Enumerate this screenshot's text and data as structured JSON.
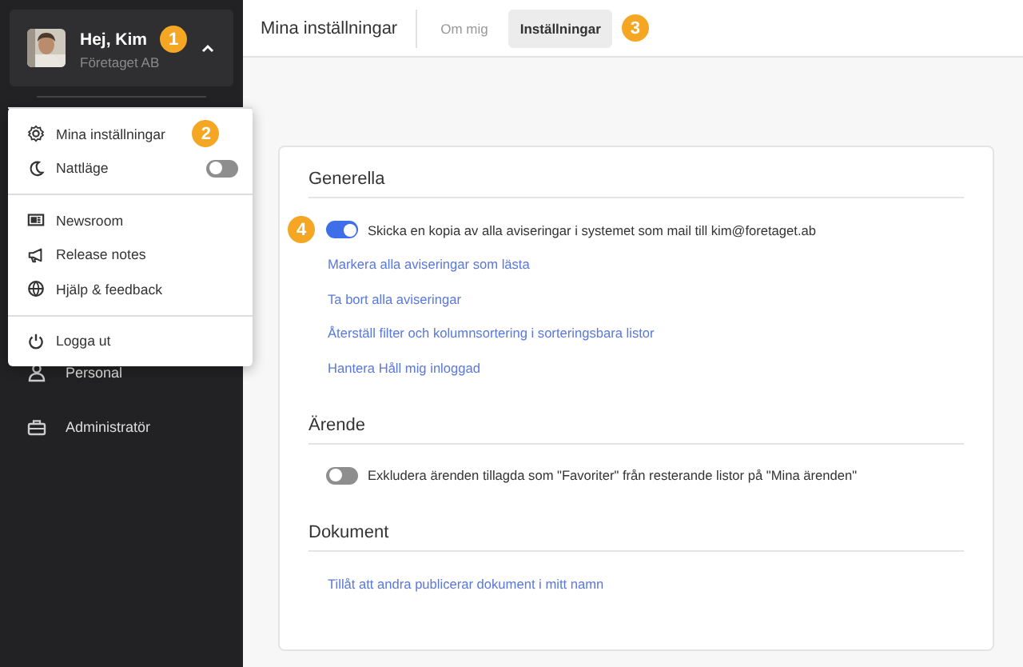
{
  "sidebar": {
    "user": {
      "greeting": "Hej, Kim",
      "company": "Företaget AB",
      "badge": "1",
      "expanded": true
    },
    "items": [
      {
        "label": "Personal"
      },
      {
        "label": "Administratör"
      }
    ]
  },
  "user_menu": {
    "groups": [
      [
        {
          "kind": "link",
          "label": "Mina inställningar",
          "badge": "2"
        },
        {
          "kind": "toggle",
          "label": "Nattläge",
          "on": false
        }
      ],
      [
        {
          "kind": "link",
          "label": "Newsroom"
        },
        {
          "kind": "link",
          "label": "Release notes"
        },
        {
          "kind": "link",
          "label": "Hjälp & feedback"
        }
      ],
      [
        {
          "kind": "link",
          "label": "Logga ut"
        }
      ]
    ]
  },
  "header": {
    "title": "Mina inställningar",
    "tabs": [
      {
        "label": "Om mig",
        "selected": false
      },
      {
        "label": "Inställningar",
        "selected": true,
        "badge": "3"
      }
    ]
  },
  "sections": [
    {
      "title": "Generella",
      "items": [
        {
          "kind": "toggle",
          "label": "Skicka en kopia av alla aviseringar i systemet som mail till kim@foretaget.ab",
          "on": true,
          "badge": "4"
        },
        {
          "kind": "link",
          "label": "Markera alla aviseringar som lästa"
        },
        {
          "kind": "link",
          "label": "Ta bort alla aviseringar"
        },
        {
          "kind": "link",
          "label": "Återställ filter och kolumnsortering i sorteringsbara listor"
        },
        {
          "kind": "link",
          "label": "Hantera Håll mig inloggad"
        }
      ]
    },
    {
      "title": "Ärende",
      "items": [
        {
          "kind": "toggle",
          "label": "Exkludera ärenden tillagda som \"Favoriter\" från resterande listor på \"Mina ärenden\"",
          "on": false
        }
      ]
    },
    {
      "title": "Dokument",
      "items": [
        {
          "kind": "link",
          "label": "Tillåt att andra publicerar dokument i mitt namn"
        }
      ]
    }
  ]
}
